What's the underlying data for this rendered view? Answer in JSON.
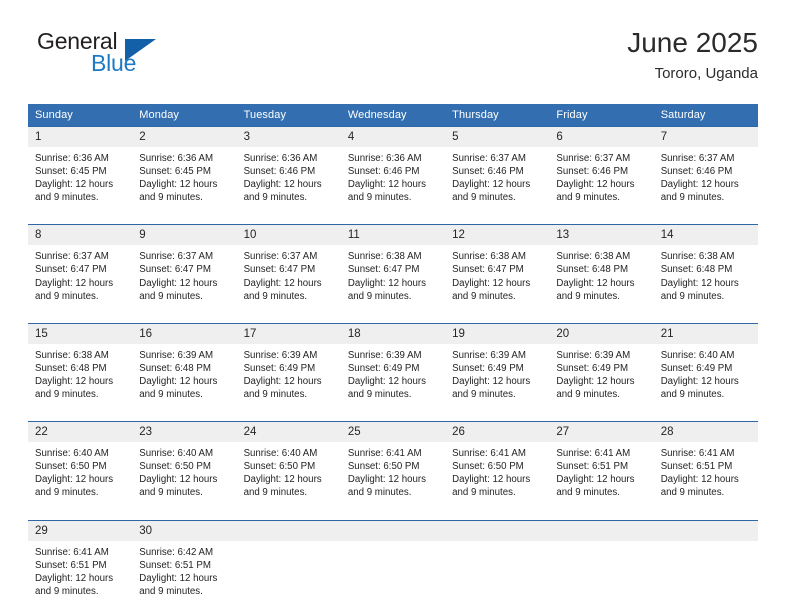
{
  "brand": {
    "name_part1": "General",
    "name_part2": "Blue",
    "logo_icon": "blue-triangle-icon",
    "accent_color": "#1360a8"
  },
  "header": {
    "title": "June 2025",
    "subtitle": "Tororo, Uganda"
  },
  "calendar": {
    "header_bg_color": "#336fb0",
    "row_border_color": "#2f66a5",
    "daynum_bg_color": "#efefef",
    "weekday_headers": [
      "Sunday",
      "Monday",
      "Tuesday",
      "Wednesday",
      "Thursday",
      "Friday",
      "Saturday"
    ],
    "labels": {
      "sunrise": "Sunrise:",
      "sunset": "Sunset:",
      "daylight": "Daylight:"
    },
    "weeks": [
      [
        {
          "day": "1",
          "sunrise": "Sunrise: 6:36 AM",
          "sunset": "Sunset: 6:45 PM",
          "daylight": "Daylight: 12 hours and 9 minutes."
        },
        {
          "day": "2",
          "sunrise": "Sunrise: 6:36 AM",
          "sunset": "Sunset: 6:45 PM",
          "daylight": "Daylight: 12 hours and 9 minutes."
        },
        {
          "day": "3",
          "sunrise": "Sunrise: 6:36 AM",
          "sunset": "Sunset: 6:46 PM",
          "daylight": "Daylight: 12 hours and 9 minutes."
        },
        {
          "day": "4",
          "sunrise": "Sunrise: 6:36 AM",
          "sunset": "Sunset: 6:46 PM",
          "daylight": "Daylight: 12 hours and 9 minutes."
        },
        {
          "day": "5",
          "sunrise": "Sunrise: 6:37 AM",
          "sunset": "Sunset: 6:46 PM",
          "daylight": "Daylight: 12 hours and 9 minutes."
        },
        {
          "day": "6",
          "sunrise": "Sunrise: 6:37 AM",
          "sunset": "Sunset: 6:46 PM",
          "daylight": "Daylight: 12 hours and 9 minutes."
        },
        {
          "day": "7",
          "sunrise": "Sunrise: 6:37 AM",
          "sunset": "Sunset: 6:46 PM",
          "daylight": "Daylight: 12 hours and 9 minutes."
        }
      ],
      [
        {
          "day": "8",
          "sunrise": "Sunrise: 6:37 AM",
          "sunset": "Sunset: 6:47 PM",
          "daylight": "Daylight: 12 hours and 9 minutes."
        },
        {
          "day": "9",
          "sunrise": "Sunrise: 6:37 AM",
          "sunset": "Sunset: 6:47 PM",
          "daylight": "Daylight: 12 hours and 9 minutes."
        },
        {
          "day": "10",
          "sunrise": "Sunrise: 6:37 AM",
          "sunset": "Sunset: 6:47 PM",
          "daylight": "Daylight: 12 hours and 9 minutes."
        },
        {
          "day": "11",
          "sunrise": "Sunrise: 6:38 AM",
          "sunset": "Sunset: 6:47 PM",
          "daylight": "Daylight: 12 hours and 9 minutes."
        },
        {
          "day": "12",
          "sunrise": "Sunrise: 6:38 AM",
          "sunset": "Sunset: 6:47 PM",
          "daylight": "Daylight: 12 hours and 9 minutes."
        },
        {
          "day": "13",
          "sunrise": "Sunrise: 6:38 AM",
          "sunset": "Sunset: 6:48 PM",
          "daylight": "Daylight: 12 hours and 9 minutes."
        },
        {
          "day": "14",
          "sunrise": "Sunrise: 6:38 AM",
          "sunset": "Sunset: 6:48 PM",
          "daylight": "Daylight: 12 hours and 9 minutes."
        }
      ],
      [
        {
          "day": "15",
          "sunrise": "Sunrise: 6:38 AM",
          "sunset": "Sunset: 6:48 PM",
          "daylight": "Daylight: 12 hours and 9 minutes."
        },
        {
          "day": "16",
          "sunrise": "Sunrise: 6:39 AM",
          "sunset": "Sunset: 6:48 PM",
          "daylight": "Daylight: 12 hours and 9 minutes."
        },
        {
          "day": "17",
          "sunrise": "Sunrise: 6:39 AM",
          "sunset": "Sunset: 6:49 PM",
          "daylight": "Daylight: 12 hours and 9 minutes."
        },
        {
          "day": "18",
          "sunrise": "Sunrise: 6:39 AM",
          "sunset": "Sunset: 6:49 PM",
          "daylight": "Daylight: 12 hours and 9 minutes."
        },
        {
          "day": "19",
          "sunrise": "Sunrise: 6:39 AM",
          "sunset": "Sunset: 6:49 PM",
          "daylight": "Daylight: 12 hours and 9 minutes."
        },
        {
          "day": "20",
          "sunrise": "Sunrise: 6:39 AM",
          "sunset": "Sunset: 6:49 PM",
          "daylight": "Daylight: 12 hours and 9 minutes."
        },
        {
          "day": "21",
          "sunrise": "Sunrise: 6:40 AM",
          "sunset": "Sunset: 6:49 PM",
          "daylight": "Daylight: 12 hours and 9 minutes."
        }
      ],
      [
        {
          "day": "22",
          "sunrise": "Sunrise: 6:40 AM",
          "sunset": "Sunset: 6:50 PM",
          "daylight": "Daylight: 12 hours and 9 minutes."
        },
        {
          "day": "23",
          "sunrise": "Sunrise: 6:40 AM",
          "sunset": "Sunset: 6:50 PM",
          "daylight": "Daylight: 12 hours and 9 minutes."
        },
        {
          "day": "24",
          "sunrise": "Sunrise: 6:40 AM",
          "sunset": "Sunset: 6:50 PM",
          "daylight": "Daylight: 12 hours and 9 minutes."
        },
        {
          "day": "25",
          "sunrise": "Sunrise: 6:41 AM",
          "sunset": "Sunset: 6:50 PM",
          "daylight": "Daylight: 12 hours and 9 minutes."
        },
        {
          "day": "26",
          "sunrise": "Sunrise: 6:41 AM",
          "sunset": "Sunset: 6:50 PM",
          "daylight": "Daylight: 12 hours and 9 minutes."
        },
        {
          "day": "27",
          "sunrise": "Sunrise: 6:41 AM",
          "sunset": "Sunset: 6:51 PM",
          "daylight": "Daylight: 12 hours and 9 minutes."
        },
        {
          "day": "28",
          "sunrise": "Sunrise: 6:41 AM",
          "sunset": "Sunset: 6:51 PM",
          "daylight": "Daylight: 12 hours and 9 minutes."
        }
      ],
      [
        {
          "day": "29",
          "sunrise": "Sunrise: 6:41 AM",
          "sunset": "Sunset: 6:51 PM",
          "daylight": "Daylight: 12 hours and 9 minutes."
        },
        {
          "day": "30",
          "sunrise": "Sunrise: 6:42 AM",
          "sunset": "Sunset: 6:51 PM",
          "daylight": "Daylight: 12 hours and 9 minutes."
        },
        {
          "day": "",
          "sunrise": "",
          "sunset": "",
          "daylight": ""
        },
        {
          "day": "",
          "sunrise": "",
          "sunset": "",
          "daylight": ""
        },
        {
          "day": "",
          "sunrise": "",
          "sunset": "",
          "daylight": ""
        },
        {
          "day": "",
          "sunrise": "",
          "sunset": "",
          "daylight": ""
        },
        {
          "day": "",
          "sunrise": "",
          "sunset": "",
          "daylight": ""
        }
      ]
    ]
  }
}
